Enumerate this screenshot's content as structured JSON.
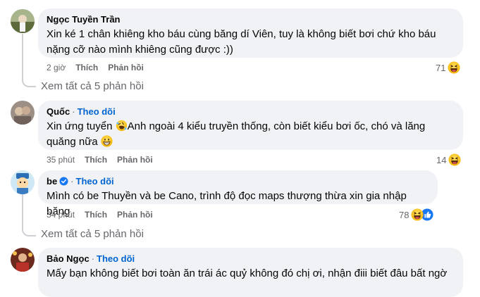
{
  "comments": [
    {
      "author": "Ngọc Tuyền Trần",
      "follow": "",
      "text": "Xin ké 1 chân khiêng kho báu cùng băng dí Viên, tuy là không biết bơi chứ kho báu nặng cỡ nào mình khiêng cũng được :))",
      "time": "2 giờ",
      "like": "Thích",
      "reply": "Phản hồi",
      "reaction_count": "71",
      "reaction_icon": "laugh-emoji-icon"
    },
    {
      "author": "Quốc",
      "follow": "Theo dõi",
      "text_a": "Xin ứng tuyển",
      "text_b": "Anh ngoài 4 kiểu truyền thống, còn biết kiểu bơi ốc, chó và lăng quăng nữa",
      "time": "35 phút",
      "like": "Thích",
      "reply": "Phản hồi",
      "reaction_count": "14",
      "reaction_icon": "laugh-emoji-icon"
    },
    {
      "author": "be",
      "follow": "Theo dõi",
      "text": "Mình có be Thuyền và be Cano, trình độ đọc maps thượng thừa xin gia nhập băng",
      "time": "34 phút",
      "like": "Thích",
      "reply": "Phản hồi",
      "reaction_count": "78",
      "reaction_icon": "laugh-like-emoji-icon"
    },
    {
      "author": "Bảo Ngọc",
      "follow": "Theo dõi",
      "text": "Mấy bạn không biết bơi toàn ăn trái ác quỷ không đó chị ơi, nhận điii biết đâu bất ngờ"
    }
  ],
  "see_all_replies": "Xem tất cả 5 phản hồi",
  "colors": {
    "bubble": "#f0f2f5",
    "link": "#0064d1",
    "muted": "#65676b"
  }
}
